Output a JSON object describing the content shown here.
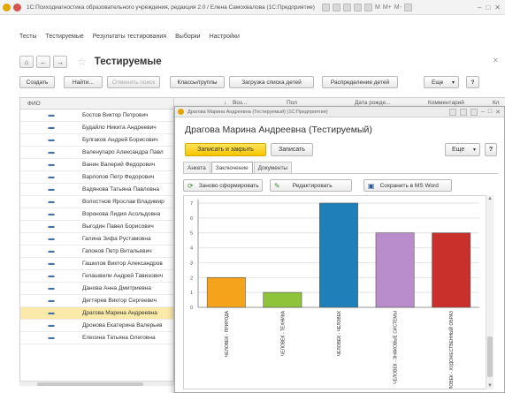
{
  "window": {
    "title": "1С:Психодиагностика образовательного учреждения, редакция 2.0 / Елена Самохвалова (1С:Предприятие)",
    "tools": [
      "M",
      "M+",
      "M-"
    ]
  },
  "menu": [
    "Тесты",
    "Тестируемые",
    "Результаты тестирования",
    "Выборки",
    "Настройки"
  ],
  "form": {
    "title": "Тестируемые"
  },
  "toolbar": {
    "create": "Создать",
    "find": "Найти...",
    "cancel_search": "Отменить поиск",
    "classes": "Классы/группы",
    "load_children": "Загрузка списка детей",
    "distribute": "Распределение детей",
    "more": "Еще",
    "help": "?"
  },
  "list": {
    "column_fio": "ФИО",
    "columns_right": [
      "Воз...",
      "Пол",
      "Дата рожде...",
      "Комментарий",
      "Кл"
    ],
    "rows": [
      {
        "name": "Бостов Виктор Петрович",
        "selected": false
      },
      {
        "name": "Будайло Никита Андреевич",
        "selected": false
      },
      {
        "name": "Булгаков Андрей Борисович",
        "selected": false
      },
      {
        "name": "Валенупаро Александра Павл",
        "selected": false
      },
      {
        "name": "Ванин Валерий Федорович",
        "selected": false
      },
      {
        "name": "Варлопов Петр Федорович",
        "selected": false
      },
      {
        "name": "Вадянова Татьяна Павловна",
        "selected": false
      },
      {
        "name": "Волостнов Ярослав Владимир",
        "selected": false
      },
      {
        "name": "Воронова Лидия Асольдовна",
        "selected": false
      },
      {
        "name": "Выгодин Павел Борисович",
        "selected": false
      },
      {
        "name": "Галина Зифа Рустамовна",
        "selected": false
      },
      {
        "name": "Гапонов Петр Витальевич",
        "selected": false
      },
      {
        "name": "Гашилов Виктор Александров",
        "selected": false
      },
      {
        "name": "Гелашвили Андрей Тавизович",
        "selected": false
      },
      {
        "name": "Данова Анна Дмитриевна",
        "selected": false
      },
      {
        "name": "Дегтярев Виктор Сергеевич",
        "selected": false
      },
      {
        "name": "Драгова Марина Андреевна",
        "selected": true
      },
      {
        "name": "Дронова Екатерина Валерьев",
        "selected": false
      },
      {
        "name": "Елесина Татьяна Олеговна",
        "selected": false
      }
    ]
  },
  "dialog": {
    "window_title": "Драгова Марина Андреевна (Тестируемый) (1С:Предприятие)",
    "heading": "Драгова Марина Андреевна (Тестируемый)",
    "save_close": "Записать и закрыть",
    "save": "Записать",
    "more": "Еще",
    "help": "?",
    "tabs": [
      "Анкета",
      "Заключение",
      "Документы"
    ],
    "active_tab": 1,
    "regenerate": "Заново сформировать",
    "edit": "Редактировать",
    "save_word": "Сохранить в MS Word"
  },
  "chart_data": {
    "type": "bar",
    "categories": [
      "ЧЕЛОВЕК - ПРИРОДА",
      "ЧЕЛОВЕК - ТЕХНИКА",
      "ЧЕЛОВЕК - ЧЕЛОВЕК",
      "ЧЕЛОВЕК - ЗНАКОВЫЕ СИСТЕМЫ",
      "ЧЕЛОВЕК - ХУДОЖЕСТВЕННЫЙ ОБРАЗ"
    ],
    "values": [
      2,
      1,
      7,
      5,
      5
    ],
    "colors": [
      "#f5a31a",
      "#8fc43a",
      "#1f7fb8",
      "#b98ccb",
      "#c9302c"
    ],
    "ylim": [
      0,
      7
    ],
    "yticks": [
      "0",
      "1",
      "2",
      "3",
      "4",
      "5",
      "6",
      "7"
    ],
    "grid": true,
    "title": "",
    "xlabel": "",
    "ylabel": ""
  }
}
